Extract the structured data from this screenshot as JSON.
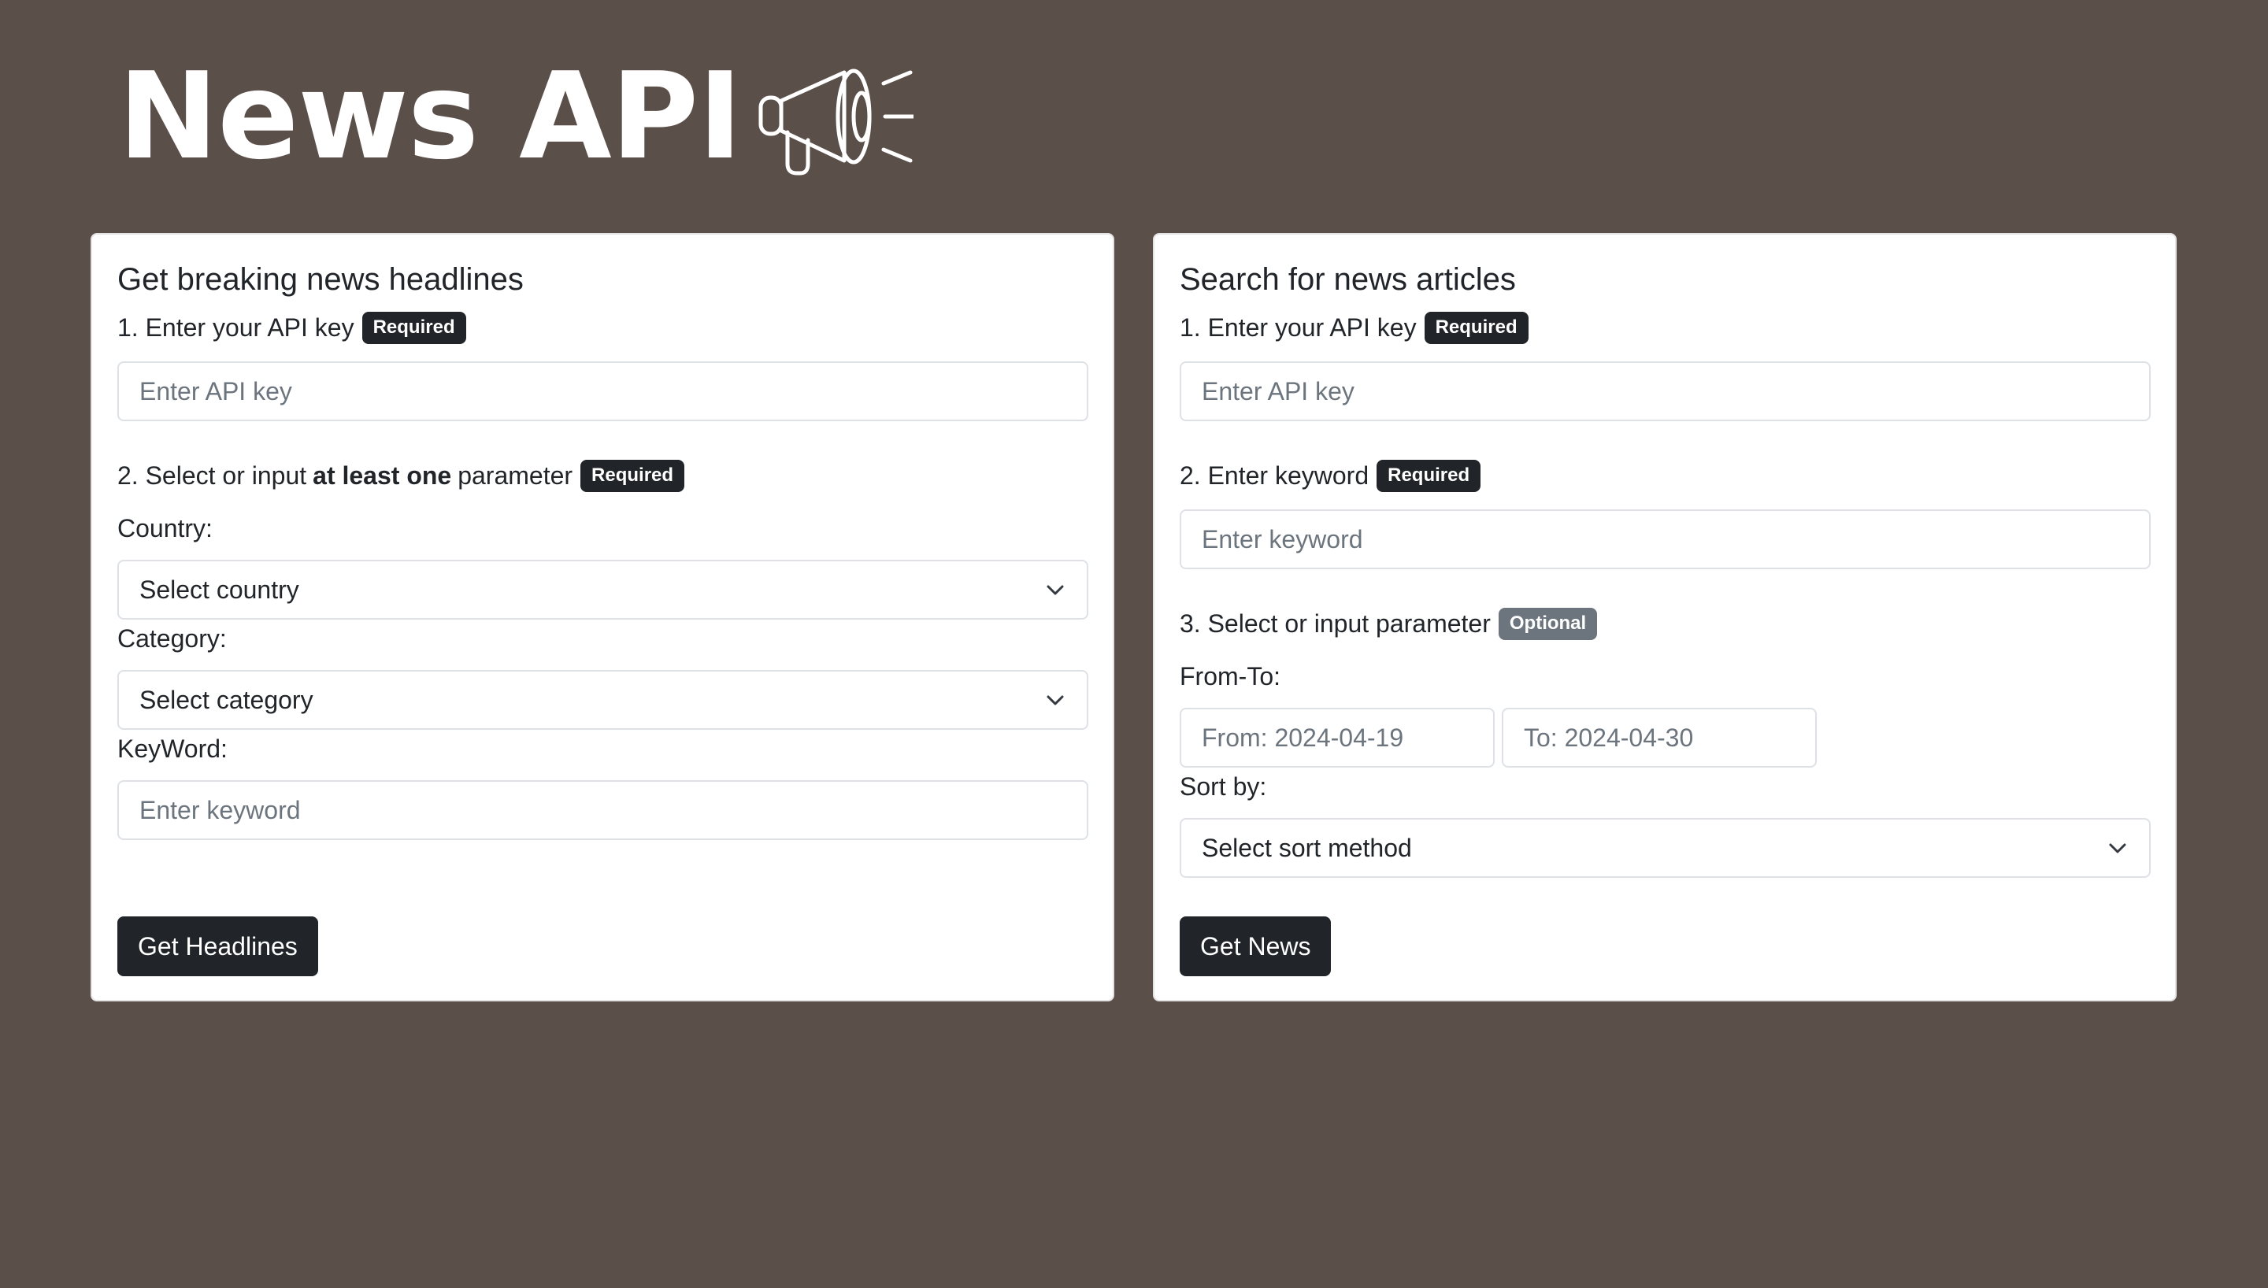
{
  "logo": {
    "text": "News API",
    "icon": "megaphone-icon"
  },
  "headlines": {
    "title": "Get breaking news headlines",
    "step1_label": "1. Enter your API key",
    "step1_badge": "Required",
    "api_key_placeholder": "Enter API key",
    "step2_prefix": "2. Select or input",
    "step2_bold": "at least one",
    "step2_suffix": "parameter",
    "step2_badge": "Required",
    "country_label": "Country:",
    "country_value": "Select country",
    "category_label": "Category:",
    "category_value": "Select category",
    "keyword_label": "KeyWord:",
    "keyword_placeholder": "Enter keyword",
    "button_label": "Get Headlines"
  },
  "search": {
    "title": "Search for news articles",
    "step1_label": "1. Enter your API key",
    "step1_badge": "Required",
    "api_key_placeholder": "Enter API key",
    "step2_label": "2. Enter keyword",
    "step2_badge": "Required",
    "keyword_placeholder": "Enter keyword",
    "step3_label": "3. Select or input parameter",
    "step3_badge": "Optional",
    "from_to_label": "From-To:",
    "from_placeholder": "From: 2024-04-19",
    "to_placeholder": "To: 2024-04-30",
    "sort_label": "Sort by:",
    "sort_value": "Select sort method",
    "button_label": "Get News"
  },
  "colors": {
    "background": "#5b4f4a",
    "card": "#ffffff",
    "button": "#212529",
    "badge_required": "#212529",
    "badge_optional": "#6c757d"
  }
}
